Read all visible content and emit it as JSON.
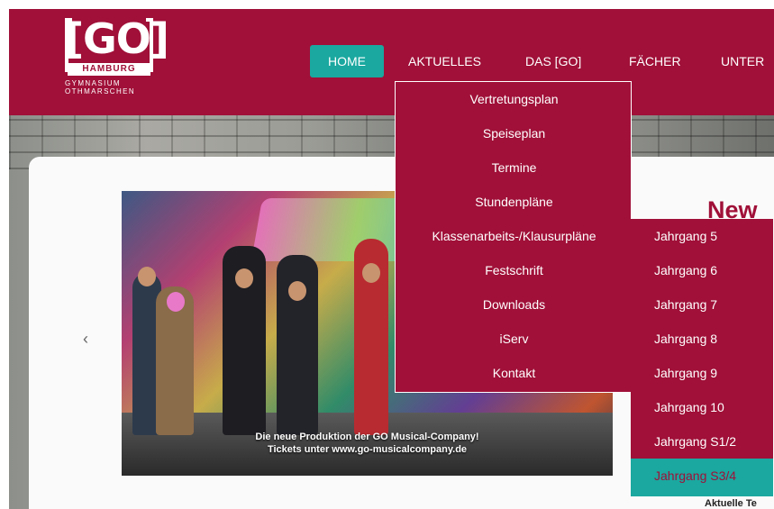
{
  "logo": {
    "text": "[GO]",
    "city": "HAMBURG",
    "subtitle_line1": "GYMNASIUM",
    "subtitle_line2": "OTHMARSCHEN"
  },
  "nav": {
    "items": [
      {
        "label": "HOME",
        "active": true
      },
      {
        "label": "AKTUELLES",
        "active": false
      },
      {
        "label": "DAS [GO]",
        "active": false
      },
      {
        "label": "FÄCHER",
        "active": false
      },
      {
        "label": "UNTER",
        "active": false
      }
    ]
  },
  "dropdown": {
    "items": [
      {
        "label": "Vertretungsplan"
      },
      {
        "label": "Speiseplan"
      },
      {
        "label": "Termine"
      },
      {
        "label": "Stundenpläne"
      },
      {
        "label": "Klassenarbeits-/Klausurpläne"
      },
      {
        "label": "Festschrift"
      },
      {
        "label": "Downloads"
      },
      {
        "label": "iServ"
      },
      {
        "label": "Kontakt"
      }
    ]
  },
  "submenu": {
    "items": [
      {
        "label": "Jahrgang 5"
      },
      {
        "label": "Jahrgang 6"
      },
      {
        "label": "Jahrgang 7"
      },
      {
        "label": "Jahrgang 8"
      },
      {
        "label": "Jahrgang 9"
      },
      {
        "label": "Jahrgang 10"
      },
      {
        "label": "Jahrgang S1/2"
      },
      {
        "label": "Jahrgang S3/4",
        "active": true
      }
    ]
  },
  "slide": {
    "caption_line1": "Die neue Produktion der GO Musical-Company!",
    "caption_line2": "Tickets unter www.go-musicalcompany.de"
  },
  "carousel": {
    "prev_icon": "chevron-left-icon",
    "prev_glyph": "‹"
  },
  "news": {
    "title": "New",
    "subtitle": "Aktuelle Te"
  },
  "colors": {
    "brand": "#a01038",
    "accent": "#1aa8a0"
  }
}
